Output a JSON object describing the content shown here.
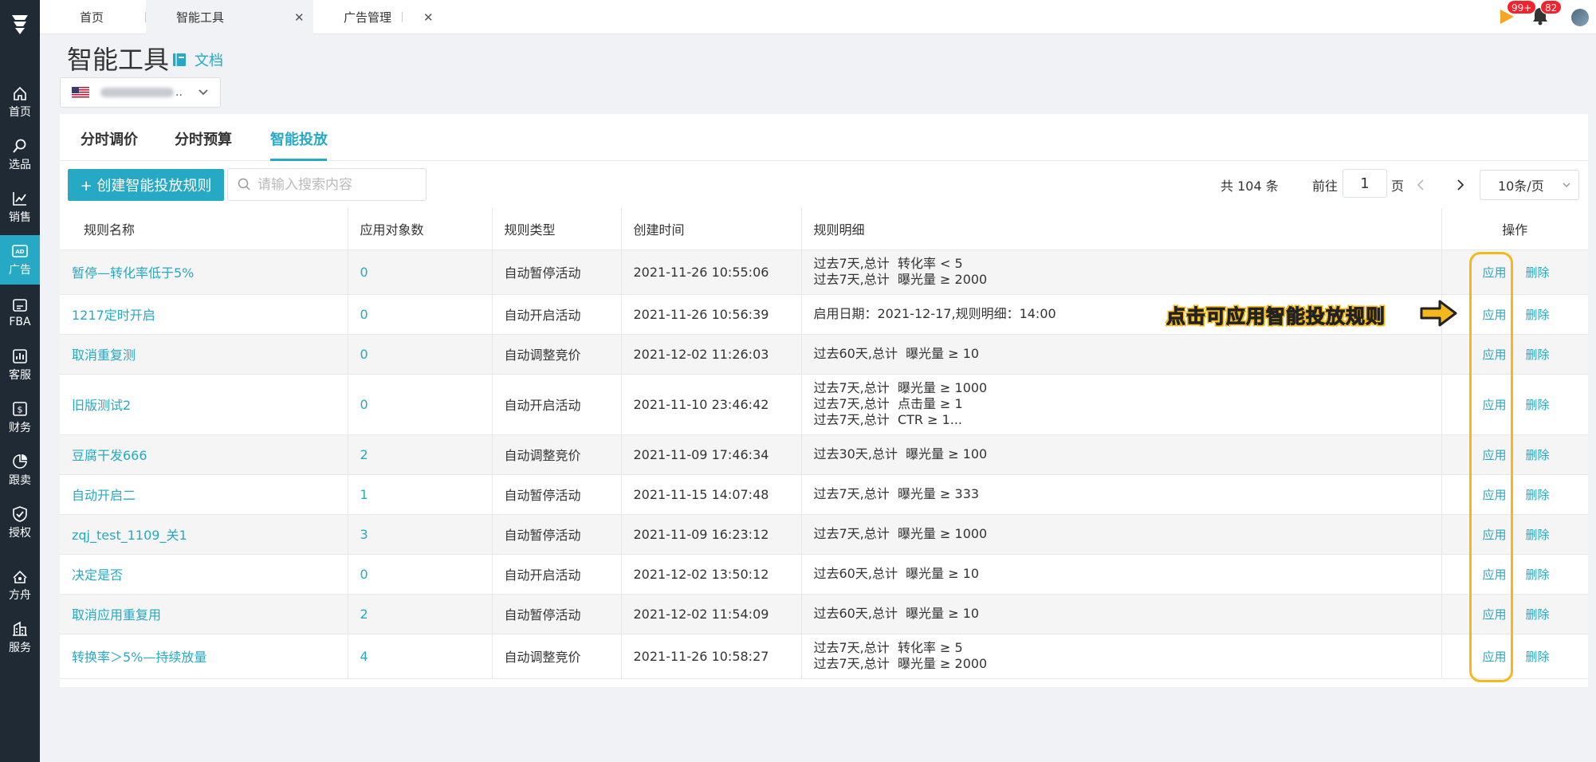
{
  "sidebar": {
    "logo": "logo-icon",
    "items": [
      {
        "label": "首页",
        "icon": "home-icon"
      },
      {
        "label": "选品",
        "icon": "search-icon"
      },
      {
        "label": "销售",
        "icon": "trend-icon"
      },
      {
        "label": "广告",
        "icon": "ad-icon"
      },
      {
        "label": "FBA",
        "icon": "fba-icon"
      },
      {
        "label": "客服",
        "icon": "chart-icon"
      },
      {
        "label": "财务",
        "icon": "dollar-icon"
      },
      {
        "label": "跟卖",
        "icon": "pie-icon"
      },
      {
        "label": "授权",
        "icon": "shield-icon"
      },
      {
        "label": "方舟",
        "icon": "ark-icon"
      },
      {
        "label": "服务",
        "icon": "building-icon"
      }
    ],
    "active_index": 3,
    "active_color": "#26a9c4"
  },
  "topbar": {
    "tabs": [
      {
        "label": "首页"
      },
      {
        "label": "智能工具"
      },
      {
        "label": "广告管理"
      }
    ],
    "badges": {
      "play": "99+",
      "bell": "82"
    }
  },
  "page": {
    "title": "智能工具",
    "doc_link": "文档",
    "account_ellipsis": ".."
  },
  "subtabs": [
    {
      "label": "分时调价"
    },
    {
      "label": "分时预算"
    },
    {
      "label": "智能投放"
    }
  ],
  "toolbar": {
    "create_label": "+ 创建智能投放规则",
    "search_placeholder": "请输入搜索内容"
  },
  "pagination": {
    "total": "共 104 条",
    "goto": "前往",
    "page": "1",
    "page_unit": "页",
    "page_size": "10条/页"
  },
  "table": {
    "headers": [
      "规则名称",
      "应用对象数",
      "规则类型",
      "创建时间",
      "规则明细",
      "操作"
    ],
    "apply_label": "应用",
    "delete_label": "删除",
    "rows": [
      {
        "name": "暂停—转化率低于5%",
        "count": "0",
        "type": "自动暂停活动",
        "created": "2021-11-26 10:55:06",
        "detail": [
          "过去7天,总计  转化率 < 5",
          "过去7天,总计  曝光量 ≥ 2000"
        ]
      },
      {
        "name": "1217定时开启",
        "count": "0",
        "type": "自动开启活动",
        "created": "2021-11-26 10:56:39",
        "detail": [
          "启用日期：2021-12-17,规则明细：14:00"
        ]
      },
      {
        "name": "取消重复测",
        "count": "0",
        "type": "自动调整竞价",
        "created": "2021-12-02 11:26:03",
        "detail": [
          "过去60天,总计  曝光量 ≥ 10"
        ]
      },
      {
        "name": "旧版测试2",
        "count": "0",
        "type": "自动开启活动",
        "created": "2021-11-10 23:46:42",
        "detail": [
          "过去7天,总计  曝光量 ≥ 1000",
          "过去7天,总计  点击量 ≥ 1",
          "过去7天,总计  CTR ≥ 1..."
        ]
      },
      {
        "name": "豆腐干发666",
        "count": "2",
        "type": "自动调整竞价",
        "created": "2021-11-09 17:46:34",
        "detail": [
          "过去30天,总计  曝光量 ≥ 100"
        ]
      },
      {
        "name": "自动开启二",
        "count": "1",
        "type": "自动暂停活动",
        "created": "2021-11-15 14:07:48",
        "detail": [
          "过去7天,总计  曝光量 ≥ 333"
        ]
      },
      {
        "name": "zqj_test_1109_关1",
        "count": "3",
        "type": "自动暂停活动",
        "created": "2021-11-09 16:23:12",
        "detail": [
          "过去7天,总计  曝光量 ≥ 1000"
        ]
      },
      {
        "name": "决定是否",
        "count": "0",
        "type": "自动开启活动",
        "created": "2021-12-02 13:50:12",
        "detail": [
          "过去60天,总计  曝光量 ≥ 10"
        ]
      },
      {
        "name": "取消应用重复用",
        "count": "2",
        "type": "自动暂停活动",
        "created": "2021-12-02 11:54:09",
        "detail": [
          "过去60天,总计  曝光量 ≥ 10"
        ]
      },
      {
        "name": "转换率＞5%—持续放量",
        "count": "4",
        "type": "自动调整竞价",
        "created": "2021-11-26 10:58:27",
        "detail": [
          "过去7天,总计  转化率 ≥ 5",
          "过去7天,总计  曝光量 ≥ 2000"
        ]
      }
    ]
  },
  "annotation": {
    "text": "点击可应用智能投放规则",
    "color": "#f5b81c"
  }
}
